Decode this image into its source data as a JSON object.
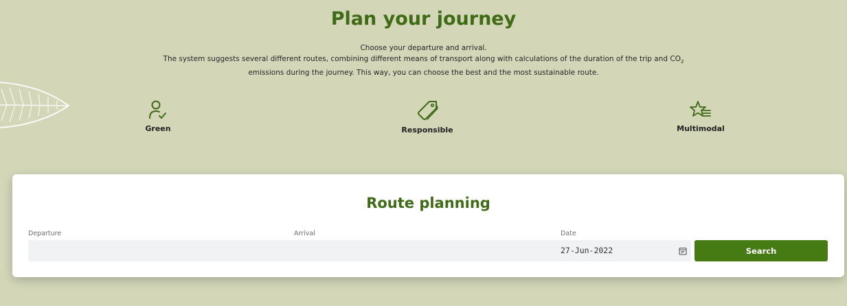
{
  "hero": {
    "title": "Plan your journey",
    "line1": "Choose your departure and arrival.",
    "line2": "The system suggests several different routes, combining different means of transport along with calculations of the duration of the trip and CO",
    "co2_subscript": "2",
    "line3": "emissions during the journey. This way, you can choose the best and the most sustainable route."
  },
  "features": [
    {
      "label": "Green",
      "icon": "user-check-icon"
    },
    {
      "label": "Responsible",
      "icon": "tag-icon"
    },
    {
      "label": "Multimodal",
      "icon": "star-list-icon"
    }
  ],
  "route": {
    "title": "Route planning",
    "departure_label": "Departure",
    "departure_value": "",
    "arrival_label": "Arrival",
    "arrival_value": "",
    "date_label": "Date",
    "date_value": "27-Jun-2022",
    "search_label": "Search"
  },
  "colors": {
    "background": "#d3d7b8",
    "accent": "#3f6a16",
    "button": "#467a13"
  }
}
